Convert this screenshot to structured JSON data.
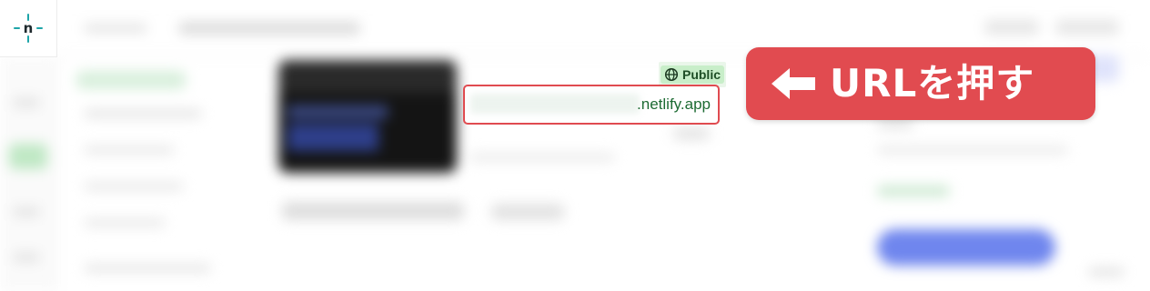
{
  "app": {
    "logo_icon": "netlify-logo-icon",
    "accent": "#1d6b33"
  },
  "site": {
    "visibility_label": "Public",
    "visibility_icon": "globe-icon",
    "url_suffix": ".netlify.app"
  },
  "annotation": {
    "text": "URLを押す",
    "arrow_icon": "arrow-left-icon",
    "color": "#e14b50"
  }
}
